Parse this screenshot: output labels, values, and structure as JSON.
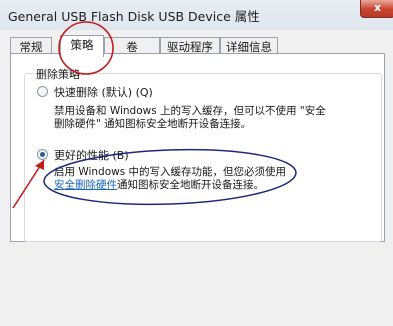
{
  "window": {
    "title": "General USB Flash Disk USB Device 属性",
    "close_glyph": "x"
  },
  "tabs": [
    {
      "label": "常规"
    },
    {
      "label": "策略"
    },
    {
      "label": "卷"
    },
    {
      "label": "驱动程序"
    },
    {
      "label": "详细信息"
    }
  ],
  "active_tab": "策略",
  "policy": {
    "group_title": "删除策略",
    "quick_removal": {
      "label": "快速删除 (默认) (Q)",
      "desc_line1": "禁用设备和 Windows 上的写入缓存，但可以不使用 \"安全",
      "desc_line2": "删除硬件\" 通知图标安全地断开设备连接。",
      "selected": false
    },
    "better_performance": {
      "label": "更好的性能 (B)",
      "desc_line1": "启用 Windows 中的写入缓存功能，但您必须使用",
      "desc_link": "安全删除硬件",
      "desc_line2_rest": "通知图标安全地断开设备连接。",
      "selected": true
    }
  },
  "annotation_color": "#c41e1e",
  "annotation_ellipse_color": "#1d2a7a"
}
